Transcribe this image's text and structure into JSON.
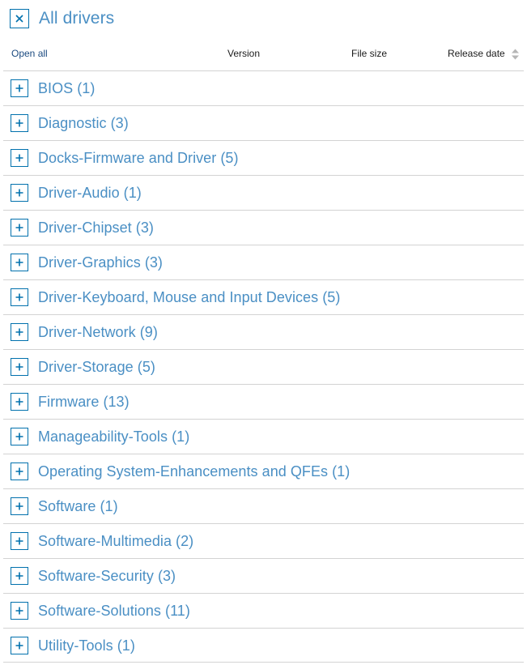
{
  "header": {
    "close_icon": "close-x-icon",
    "title": "All drivers"
  },
  "table": {
    "open_all_label": "Open all",
    "columns": {
      "version": "Version",
      "file_size": "File size",
      "release_date": "Release date"
    },
    "sort_icon": "sort-updown-icon",
    "expand_icon": "plus-icon",
    "rows": [
      {
        "label": "BIOS (1)"
      },
      {
        "label": "Diagnostic (3)"
      },
      {
        "label": "Docks-Firmware and Driver (5)"
      },
      {
        "label": "Driver-Audio (1)"
      },
      {
        "label": "Driver-Chipset (3)"
      },
      {
        "label": "Driver-Graphics (3)"
      },
      {
        "label": "Driver-Keyboard, Mouse and Input Devices (5)"
      },
      {
        "label": "Driver-Network (9)"
      },
      {
        "label": "Driver-Storage (5)"
      },
      {
        "label": "Firmware (13)"
      },
      {
        "label": "Manageability-Tools (1)"
      },
      {
        "label": "Operating System-Enhancements and QFEs (1)"
      },
      {
        "label": "Software (1)"
      },
      {
        "label": "Software-Multimedia (2)"
      },
      {
        "label": "Software-Security (3)"
      },
      {
        "label": "Software-Solutions (11)"
      },
      {
        "label": "Utility-Tools (1)"
      }
    ]
  },
  "colors": {
    "link_blue": "#4a8fc4",
    "accent_blue": "#0171ad",
    "header_text": "#1b1b1b",
    "divider": "#d3d3d3",
    "sort_gray": "#b6b6b6"
  }
}
